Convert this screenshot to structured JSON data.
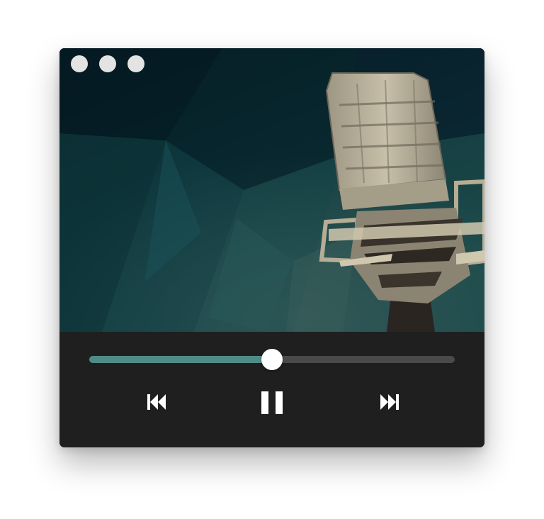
{
  "window": {
    "traffic_lights": [
      {
        "name": "close",
        "color": "#e3e3e3"
      },
      {
        "name": "minimize",
        "color": "#e3e3e3"
      },
      {
        "name": "maximize",
        "color": "#e3e3e3"
      }
    ]
  },
  "artwork": {
    "subject": "microphone-artwork",
    "palette": {
      "background": "#0b2b30",
      "accent": "#2e6d6b",
      "microphone": "#b9b29c"
    }
  },
  "player": {
    "progress_fraction": 0.5,
    "colors": {
      "played": "#4f8c87",
      "remaining": "#4a4a4a",
      "thumb": "#ffffff",
      "bar_bg": "#1f1f1f"
    },
    "controls": [
      {
        "name": "previous",
        "icon": "skip-previous-icon"
      },
      {
        "name": "pause",
        "icon": "pause-icon"
      },
      {
        "name": "next",
        "icon": "skip-next-icon"
      }
    ]
  }
}
